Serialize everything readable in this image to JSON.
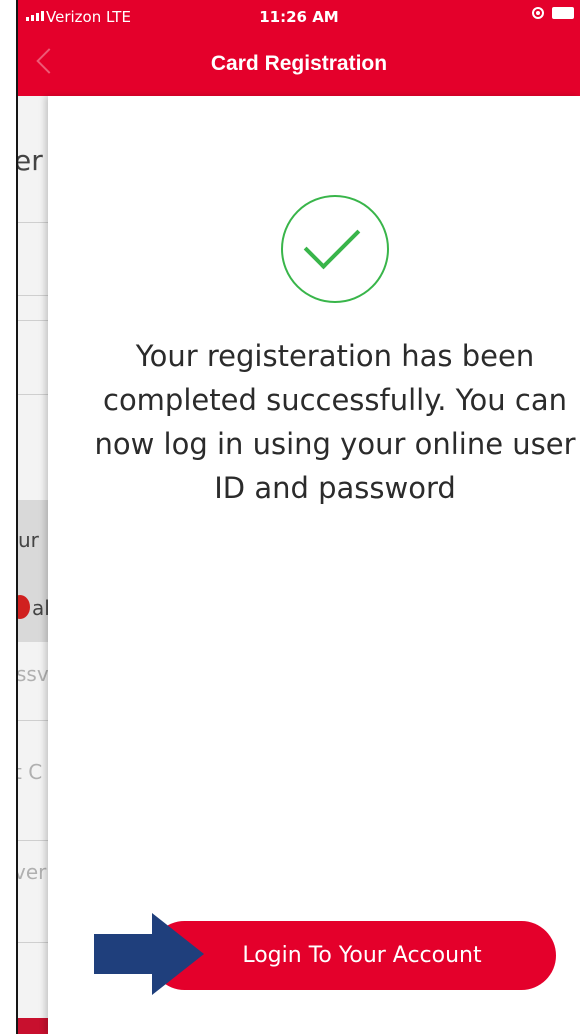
{
  "status_bar": {
    "carrier": "Verizon  LTE",
    "time": "11:26 AM"
  },
  "nav": {
    "title": "Card Registration"
  },
  "background_fragments": {
    "row1": "er",
    "row2": "ur",
    "row3": "al",
    "row4": "ssv",
    "row5": "t C",
    "row6": "ver"
  },
  "modal": {
    "icon": "checkmark-circle-icon",
    "message": "Your registeration has been completed successfully. You can now log in using your online user ID and password",
    "button_label": "Login To Your Account"
  },
  "colors": {
    "brand_red": "#E4002B",
    "success_green": "#39b54a",
    "arrow_blue": "#1f3f7c"
  }
}
